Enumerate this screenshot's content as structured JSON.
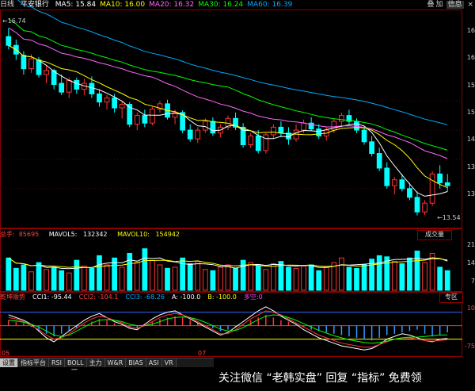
{
  "toolbar": {
    "period_label": "日线",
    "stock_name": "平安银行",
    "icons": [
      "bookmark-icon",
      "grid-icon",
      "cross-icon"
    ],
    "right_labels": [
      "叠",
      "加",
      "信息"
    ]
  },
  "ma_legend": [
    {
      "label": "MA5:",
      "value": "15.84",
      "color": "#ffffff"
    },
    {
      "label": "MA10:",
      "value": "16.00",
      "color": "#ffff00"
    },
    {
      "label": "MA20:",
      "value": "16.32",
      "color": "#ff66ff"
    },
    {
      "label": "MA30:",
      "value": "16.24",
      "color": "#00ff00"
    },
    {
      "label": "MA60:",
      "value": "16.39",
      "color": "#00aaff"
    }
  ],
  "price_annotations": {
    "high": "16.74",
    "low": "13.54"
  },
  "price_axis": [
    "16",
    "16",
    "15",
    "15",
    "14",
    "13",
    "13"
  ],
  "volume_header": {
    "label": "总手:",
    "value": "85695",
    "mavol5_label": "MAVOL5:",
    "mavol5": "132342",
    "mavol10_label": "MAVOL10:",
    "mavol10": "154942"
  },
  "volume_select": "成交量",
  "volume_axis": [
    "21",
    "14",
    "7"
  ],
  "cci_header": {
    "name": "乾坤顺势",
    "items": [
      {
        "text": "CCI1: -95.44",
        "color": "#ffffff"
      },
      {
        "text": "CCI2: -104.1",
        "color": "#ff4444"
      },
      {
        "text": "CCI3: -68.26",
        "color": "#00aaff"
      },
      {
        "text": "A: -100.0",
        "color": "#ffffff"
      },
      {
        "text": "B: -100.0",
        "color": "#ffff00"
      },
      {
        "text": "多空:0",
        "color": "#ff44ff"
      }
    ]
  },
  "cci_select": "专区",
  "cci_axis": [
    "10",
    "-75"
  ],
  "x_axis": {
    "left_label": "05",
    "date_box": "2012-05-21-一",
    "date_suffix": "05",
    "mid_label": "07"
  },
  "tabs": [
    "设置",
    "指标平台",
    "RSI",
    "BOLL",
    "主力",
    "W&R",
    "BIAS",
    "ASI",
    "VR"
  ],
  "active_tab": "设置",
  "watermark": "关注微信 “老韩实盘” 回复 “指标” 免费领",
  "chart_data": {
    "type": "candlestick",
    "title": "平安银行",
    "period": "日线",
    "price": {
      "ohlc": [
        [
          16.6,
          16.74,
          16.38,
          16.45
        ],
        [
          16.45,
          16.55,
          16.2,
          16.3
        ],
        [
          16.28,
          16.35,
          15.95,
          16.05
        ],
        [
          16.05,
          16.3,
          15.98,
          16.22
        ],
        [
          16.2,
          16.25,
          15.9,
          15.95
        ],
        [
          15.95,
          16.1,
          15.8,
          16.02
        ],
        [
          16.02,
          16.05,
          15.7,
          15.78
        ],
        [
          15.8,
          15.95,
          15.6,
          15.65
        ],
        [
          15.65,
          15.9,
          15.55,
          15.85
        ],
        [
          15.85,
          15.9,
          15.62,
          15.7
        ],
        [
          15.7,
          15.88,
          15.6,
          15.8
        ],
        [
          15.8,
          15.92,
          15.55,
          15.62
        ],
        [
          15.62,
          15.7,
          15.4,
          15.48
        ],
        [
          15.48,
          15.6,
          15.35,
          15.55
        ],
        [
          15.55,
          15.62,
          15.3,
          15.38
        ],
        [
          15.38,
          15.5,
          15.2,
          15.44
        ],
        [
          15.44,
          15.48,
          15.05,
          15.1
        ],
        [
          15.1,
          15.3,
          15.0,
          15.25
        ],
        [
          15.25,
          15.35,
          15.05,
          15.12
        ],
        [
          15.12,
          15.4,
          15.08,
          15.36
        ],
        [
          15.36,
          15.5,
          15.3,
          15.45
        ],
        [
          15.45,
          15.52,
          15.18,
          15.22
        ],
        [
          15.22,
          15.35,
          15.1,
          15.3
        ],
        [
          15.3,
          15.34,
          14.95,
          15.0
        ],
        [
          15.0,
          15.1,
          14.8,
          14.85
        ],
        [
          14.85,
          15.05,
          14.78,
          15.0
        ],
        [
          15.0,
          15.2,
          14.95,
          15.15
        ],
        [
          15.15,
          15.22,
          14.9,
          14.95
        ],
        [
          14.95,
          15.1,
          14.88,
          15.05
        ],
        [
          15.05,
          15.25,
          15.0,
          15.2
        ],
        [
          15.2,
          15.3,
          15.0,
          15.05
        ],
        [
          15.05,
          15.12,
          14.7,
          14.75
        ],
        [
          14.75,
          14.95,
          14.7,
          14.9
        ],
        [
          14.9,
          15.0,
          14.6,
          14.65
        ],
        [
          14.65,
          14.95,
          14.6,
          14.92
        ],
        [
          14.92,
          15.1,
          14.85,
          15.05
        ],
        [
          15.05,
          15.15,
          14.88,
          14.95
        ],
        [
          14.95,
          15.05,
          14.75,
          14.85
        ],
        [
          14.85,
          15.1,
          14.8,
          15.0
        ],
        [
          15.0,
          15.18,
          14.95,
          15.12
        ],
        [
          15.12,
          15.22,
          14.98,
          15.02
        ],
        [
          15.02,
          15.1,
          14.85,
          14.9
        ],
        [
          14.9,
          15.05,
          14.82,
          15.0
        ],
        [
          15.0,
          15.2,
          14.95,
          15.15
        ],
        [
          15.15,
          15.3,
          15.05,
          15.25
        ],
        [
          15.25,
          15.35,
          15.1,
          15.15
        ],
        [
          15.15,
          15.2,
          14.95,
          15.0
        ],
        [
          15.0,
          15.05,
          14.75,
          14.8
        ],
        [
          14.8,
          14.9,
          14.55,
          14.6
        ],
        [
          14.6,
          14.7,
          14.3,
          14.35
        ],
        [
          14.35,
          14.45,
          14.0,
          14.05
        ],
        [
          14.05,
          14.2,
          13.9,
          14.15
        ],
        [
          14.15,
          14.25,
          13.95,
          14.0
        ],
        [
          14.0,
          14.1,
          13.8,
          13.85
        ],
        [
          13.85,
          13.95,
          13.54,
          13.6
        ],
        [
          13.6,
          13.8,
          13.55,
          13.75
        ],
        [
          13.75,
          14.3,
          13.7,
          14.25
        ],
        [
          14.25,
          14.4,
          14.0,
          14.1
        ],
        [
          14.1,
          14.25,
          13.95,
          14.05
        ]
      ],
      "ylim": [
        13.4,
        16.9
      ],
      "ma_series": [
        {
          "name": "MA5",
          "color": "#ffffff"
        },
        {
          "name": "MA10",
          "color": "#ffff00"
        },
        {
          "name": "MA20",
          "color": "#ff66ff"
        },
        {
          "name": "MA30",
          "color": "#00ff00"
        },
        {
          "name": "MA60",
          "color": "#00aaff"
        }
      ]
    },
    "volume": {
      "values": [
        140,
        95,
        110,
        80,
        120,
        90,
        100,
        85,
        75,
        130,
        105,
        95,
        150,
        110,
        140,
        100,
        160,
        120,
        180,
        130,
        110,
        95,
        100,
        140,
        115,
        125,
        90,
        85,
        100,
        110,
        95,
        130,
        120,
        105,
        90,
        115,
        125,
        100,
        95,
        105,
        110,
        85,
        100,
        120,
        140,
        100,
        95,
        110,
        135,
        150,
        145,
        125,
        115,
        140,
        170,
        120,
        160,
        100,
        85
      ],
      "ylim": [
        0,
        220
      ],
      "mavol_series": [
        {
          "name": "MAVOL5",
          "color": "#ffffff"
        },
        {
          "name": "MAVOL10",
          "color": "#ffff00"
        }
      ]
    },
    "cci": {
      "bars": [
        40,
        30,
        20,
        -10,
        -40,
        -60,
        -80,
        -60,
        -40,
        -20,
        10,
        30,
        50,
        40,
        20,
        10,
        -10,
        -20,
        10,
        30,
        50,
        60,
        70,
        60,
        40,
        20,
        0,
        -20,
        -40,
        -30,
        -10,
        10,
        40,
        60,
        80,
        60,
        40,
        30,
        10,
        -10,
        -30,
        -40,
        -50,
        -60,
        -70,
        -80,
        -90,
        -100,
        -110,
        -90,
        -70,
        -60,
        -50,
        -40,
        -30,
        -60,
        -80,
        -70,
        -50
      ],
      "cci1": [
        80,
        60,
        40,
        10,
        -40,
        -90,
        -120,
        -80,
        -40,
        0,
        40,
        70,
        90,
        60,
        30,
        10,
        -20,
        -30,
        10,
        50,
        80,
        100,
        110,
        80,
        50,
        20,
        -10,
        -40,
        -70,
        -50,
        -10,
        30,
        70,
        110,
        140,
        110,
        70,
        40,
        10,
        -30,
        -60,
        -90,
        -110,
        -130,
        -150,
        -160,
        -170,
        -180,
        -170,
        -140,
        -100,
        -80,
        -60,
        -70,
        -90,
        -110,
        -120,
        -100,
        -95
      ],
      "cci2": [
        60,
        50,
        30,
        0,
        -30,
        -70,
        -100,
        -90,
        -60,
        -20,
        20,
        50,
        70,
        60,
        40,
        20,
        -10,
        -20,
        0,
        30,
        60,
        80,
        90,
        80,
        60,
        30,
        0,
        -30,
        -60,
        -60,
        -30,
        10,
        50,
        80,
        110,
        100,
        80,
        50,
        20,
        -10,
        -40,
        -70,
        -90,
        -110,
        -130,
        -140,
        -150,
        -160,
        -160,
        -140,
        -120,
        -100,
        -90,
        -90,
        -100,
        -110,
        -115,
        -110,
        -104
      ],
      "cci3": [
        40,
        35,
        25,
        10,
        -10,
        -40,
        -70,
        -80,
        -70,
        -40,
        -10,
        20,
        40,
        45,
        40,
        30,
        10,
        0,
        0,
        10,
        30,
        50,
        60,
        65,
        60,
        45,
        25,
        0,
        -25,
        -40,
        -35,
        -15,
        15,
        45,
        70,
        80,
        75,
        60,
        40,
        15,
        -10,
        -35,
        -55,
        -75,
        -90,
        -105,
        -115,
        -125,
        -130,
        -125,
        -115,
        -100,
        -90,
        -85,
        -85,
        -80,
        -75,
        -70,
        -68
      ],
      "ylim": [
        -220,
        180
      ],
      "A": -100.0,
      "B": -100.0
    }
  }
}
